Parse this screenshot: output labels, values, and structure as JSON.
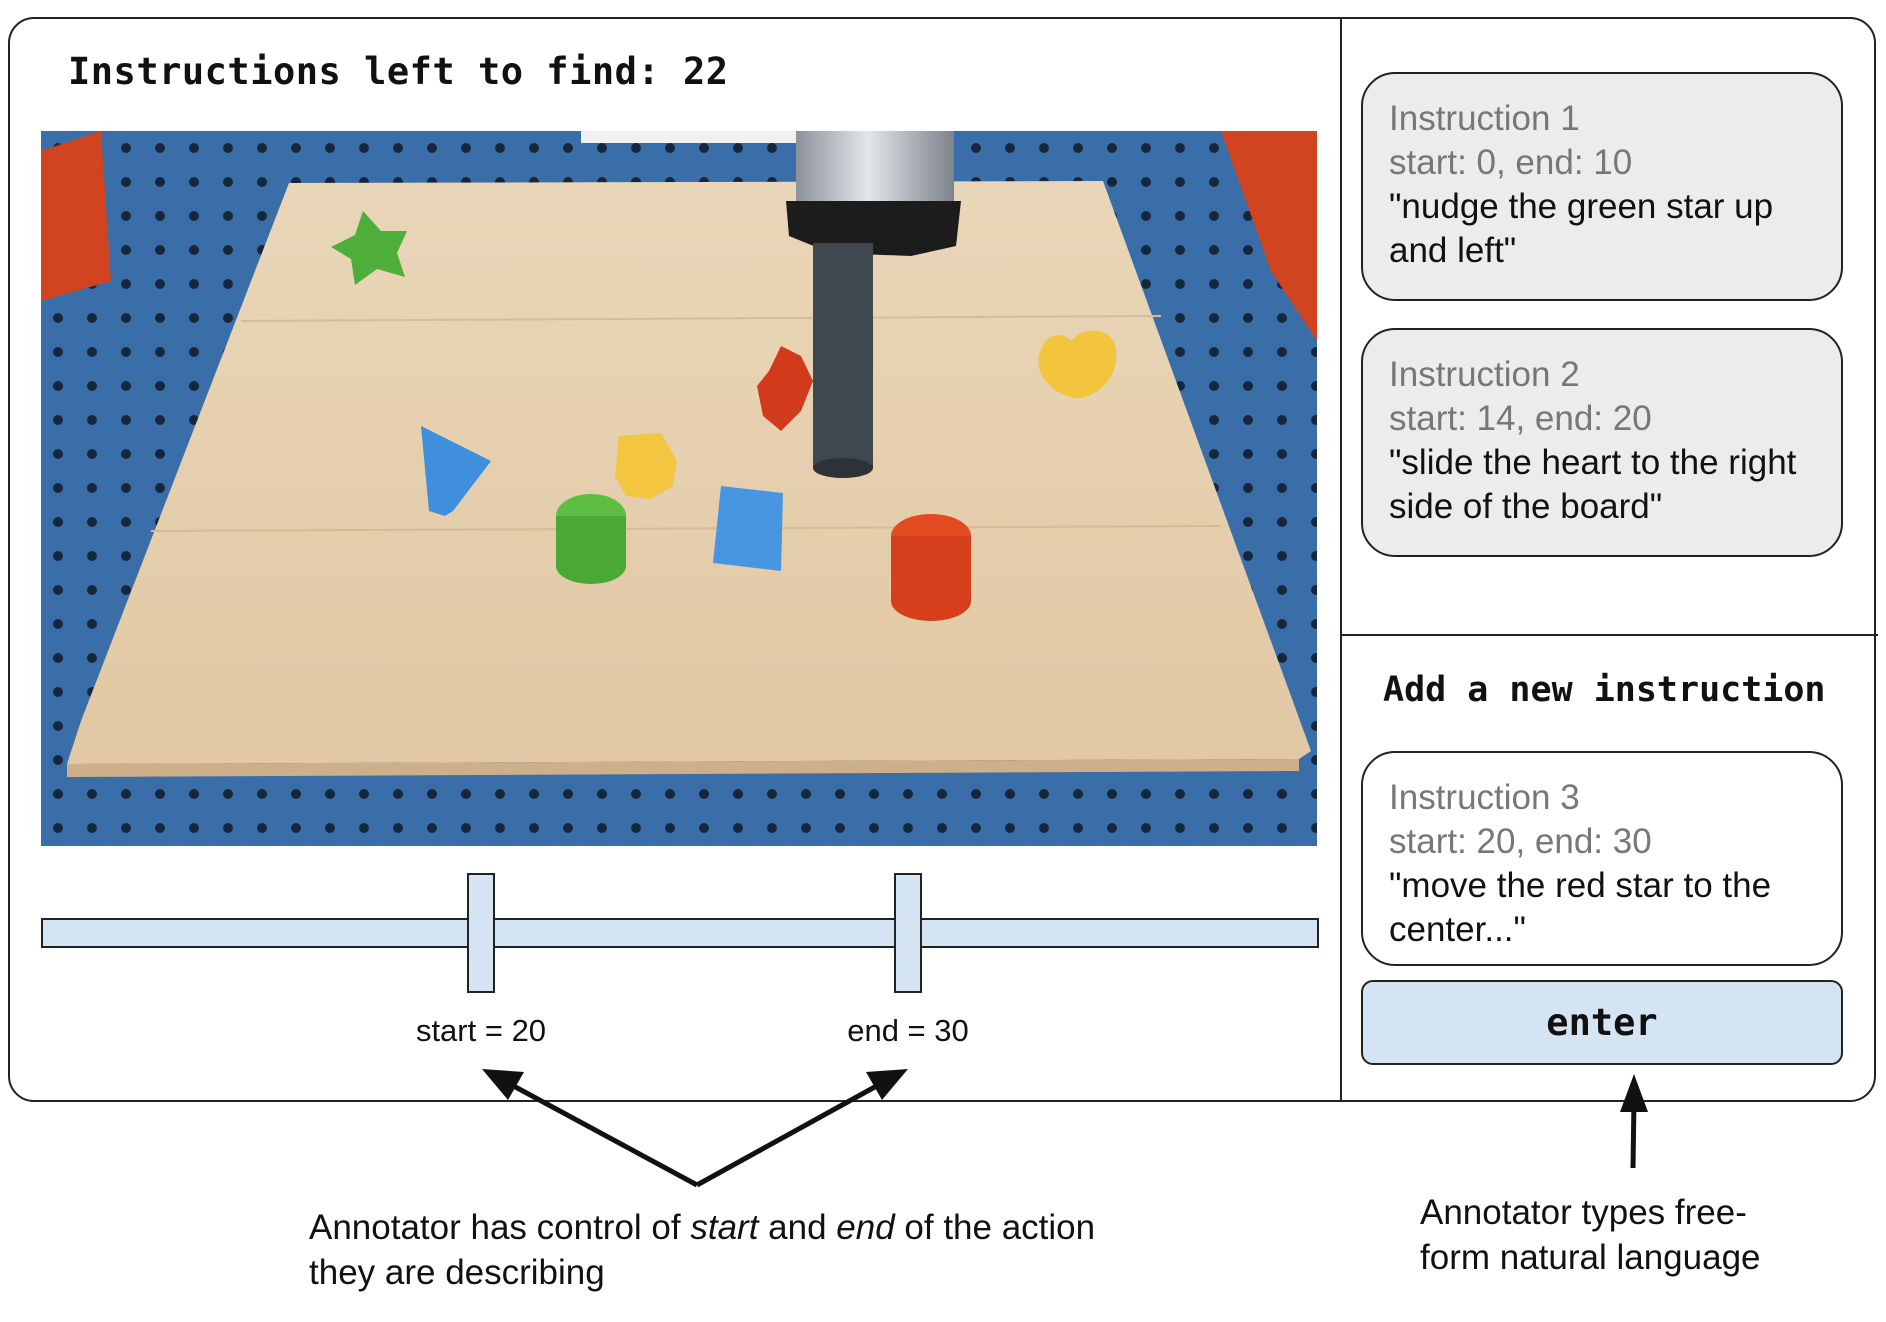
{
  "header": {
    "counter_text": "Instructions left to find: 22"
  },
  "timeline": {
    "start_label": "start = 20",
    "end_label": "end = 30"
  },
  "instructions": [
    {
      "title": "Instruction 1",
      "range": "start: 0, end: 10",
      "text": "\"nudge the green star up and left\""
    },
    {
      "title": "Instruction 2",
      "range": "start: 14, end: 20",
      "text": "\"slide the heart to the right side of the board\""
    }
  ],
  "new_instruction": {
    "heading": "Add a new instruction",
    "draft": {
      "title": "Instruction 3",
      "range": "start: 20, end: 30",
      "text": "\"move the red star to the center...\""
    },
    "button_label": "enter"
  },
  "annotations": {
    "left": {
      "part1": "Annotator has control of ",
      "start_word": "start",
      "part2": " and ",
      "end_word": "end",
      "part3": " of the action they are describing"
    },
    "right": "Annotator types free-form natural language"
  },
  "colors": {
    "track_fill": "#d5e4f3",
    "card_fill": "#ececec",
    "table_blue": "#3a6ea8",
    "board_wood": "#e5cfae"
  },
  "scene_objects": [
    "green-star-block",
    "red-star-block",
    "yellow-heart-block",
    "blue-triangle-block",
    "yellow-hexagon-block",
    "green-cylinder-block",
    "blue-cube-block",
    "red-cylinder-block",
    "robot-arm"
  ]
}
